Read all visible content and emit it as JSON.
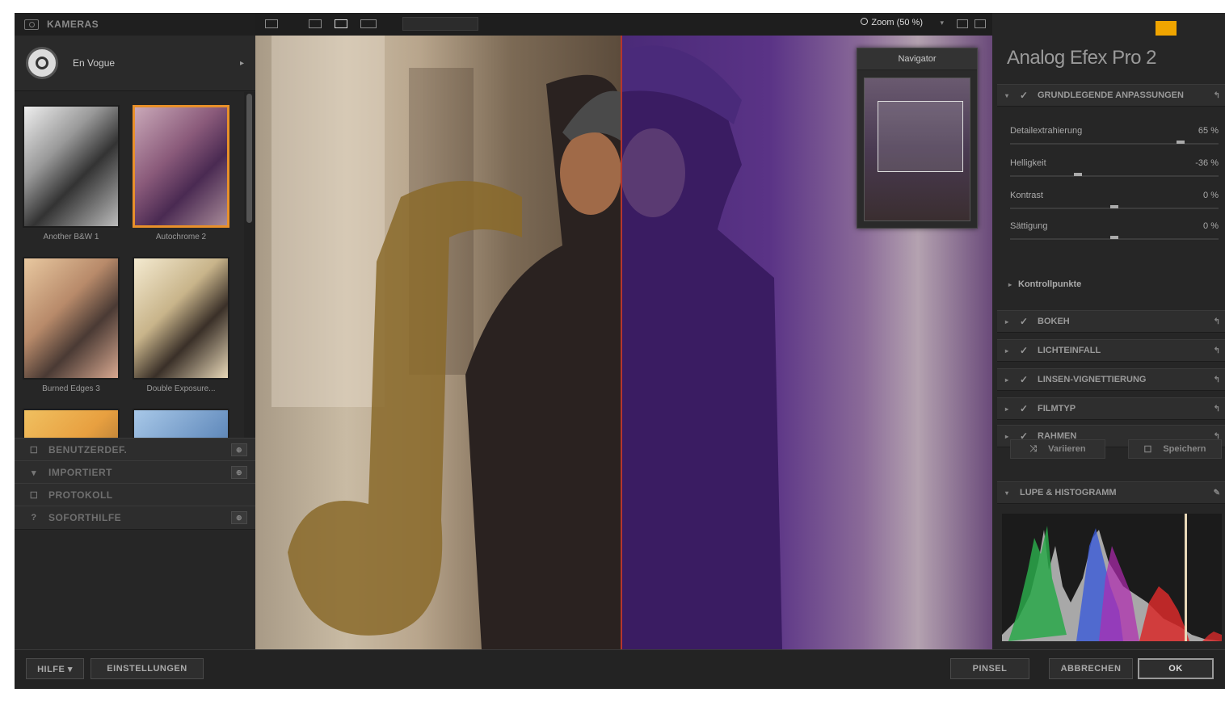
{
  "left_panel": {
    "header": "KAMERAS",
    "preset": {
      "name": "En Vogue",
      "arrow": "▸"
    },
    "thumbnails": [
      {
        "caption": "Another B&W 1",
        "selected": false,
        "style": "bw"
      },
      {
        "caption": "Autochrome 2",
        "selected": true,
        "style": "purple"
      },
      {
        "caption": "Burned Edges 3",
        "selected": false,
        "style": "warm"
      },
      {
        "caption": "Double Exposure...",
        "selected": false,
        "style": "cream"
      },
      {
        "caption": "",
        "selected": false,
        "style": "yellow"
      },
      {
        "caption": "",
        "selected": false,
        "style": "blue"
      }
    ],
    "sections": [
      {
        "label": "BENUTZERDEF.",
        "icon": "☐",
        "pin": "⊕"
      },
      {
        "label": "IMPORTIERT",
        "icon": "▾",
        "pin": "⊕"
      },
      {
        "label": "PROTOKOLL",
        "icon": "☐",
        "pin": ""
      },
      {
        "label": "SOFORTHILFE",
        "icon": "?",
        "pin": "⊕"
      }
    ]
  },
  "toolbar": {
    "zoom_label": "Zoom (50 %)",
    "zoom_arrow": "▾"
  },
  "navigator": {
    "title": "Navigator"
  },
  "right_panel": {
    "title": "Analog Efex Pro 2",
    "basic_section": "GRUNDLEGENDE ANPASSUNGEN",
    "sliders": [
      {
        "name": "Detailextrahierung",
        "value": "65 %",
        "pos": 0.83
      },
      {
        "name": "Helligkeit",
        "value": "-36 %",
        "pos": 0.32
      },
      {
        "name": "Kontrast",
        "value": "0 %",
        "pos": 0.5
      },
      {
        "name": "Sättigung",
        "value": "0 %",
        "pos": 0.5
      }
    ],
    "kontrollpunkte": "Kontrollpunkte",
    "effect_sections": [
      {
        "label": "BOKEH"
      },
      {
        "label": "LICHTEINFALL"
      },
      {
        "label": "LINSEN-VIGNETTIERUNG"
      },
      {
        "label": "FILMTYP"
      },
      {
        "label": "RAHMEN"
      }
    ],
    "variieren": "Variieren",
    "speichern": "Speichern",
    "lupe_section": "LUPE & HISTOGRAMM"
  },
  "bottom_bar": {
    "hilfe": "HILFE ▾",
    "einstellungen": "EINSTELLUNGEN",
    "pinsel": "PINSEL",
    "abbrechen": "ABBRECHEN",
    "ok": "OK"
  },
  "colors": {
    "accent_orange": "#e8902a",
    "split_line": "#b5362d",
    "panel_bg": "#262626"
  }
}
